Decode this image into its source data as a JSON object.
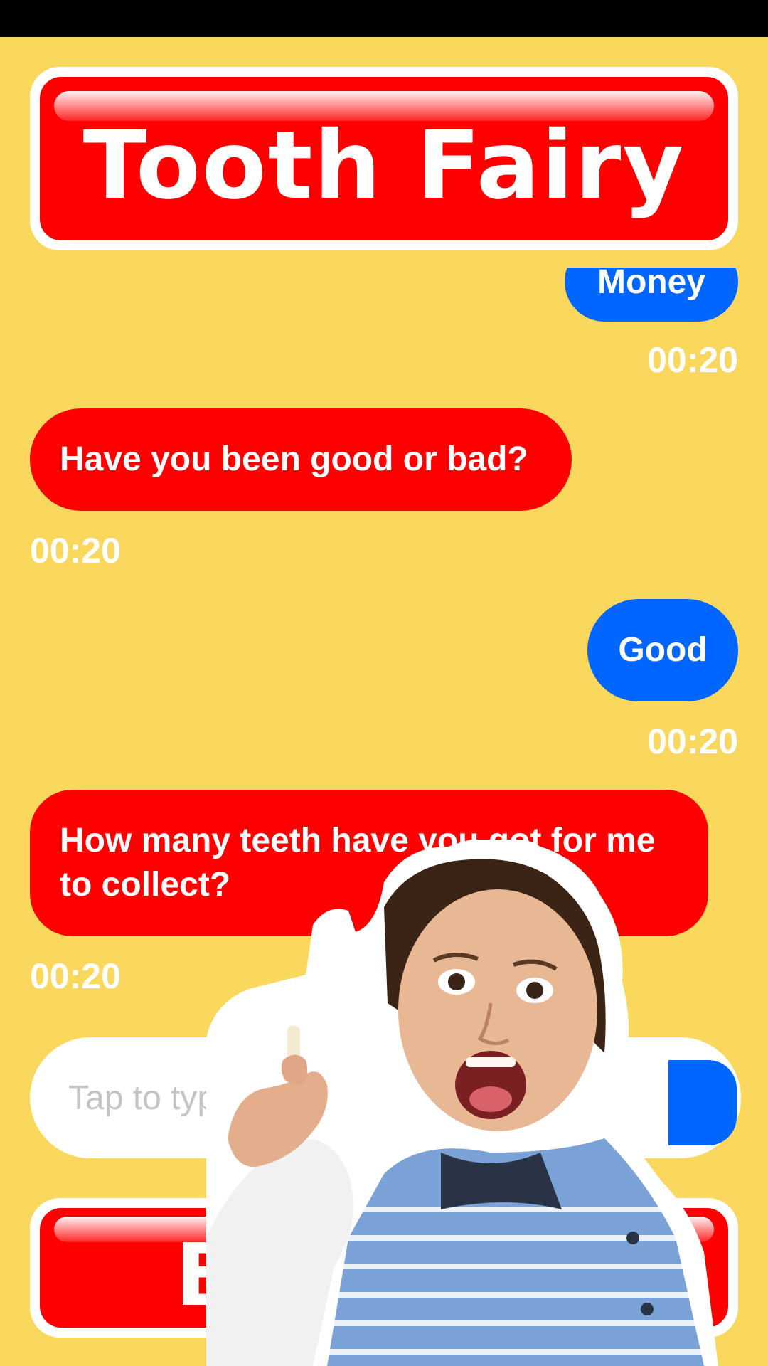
{
  "app": {
    "title": "Tooth Fairy"
  },
  "messages": [
    {
      "side": "out",
      "text": "Money",
      "time": "00:20"
    },
    {
      "side": "in",
      "text": "Have you been good or bad?",
      "time": "00:20"
    },
    {
      "side": "out",
      "text": "Good",
      "time": "00:20"
    },
    {
      "side": "in",
      "text": "How many teeth have you got for me to collect?",
      "time": "00:20"
    }
  ],
  "input": {
    "placeholder": "Tap to type"
  },
  "bottom_button": {
    "label": "B"
  },
  "colors": {
    "background": "#fad75d",
    "brand_red": "#ff0000",
    "outgoing_bubble": "#0066ff",
    "text_light": "#ffffff",
    "placeholder": "#c4c4c4"
  },
  "icons": {
    "send": "send-icon"
  }
}
